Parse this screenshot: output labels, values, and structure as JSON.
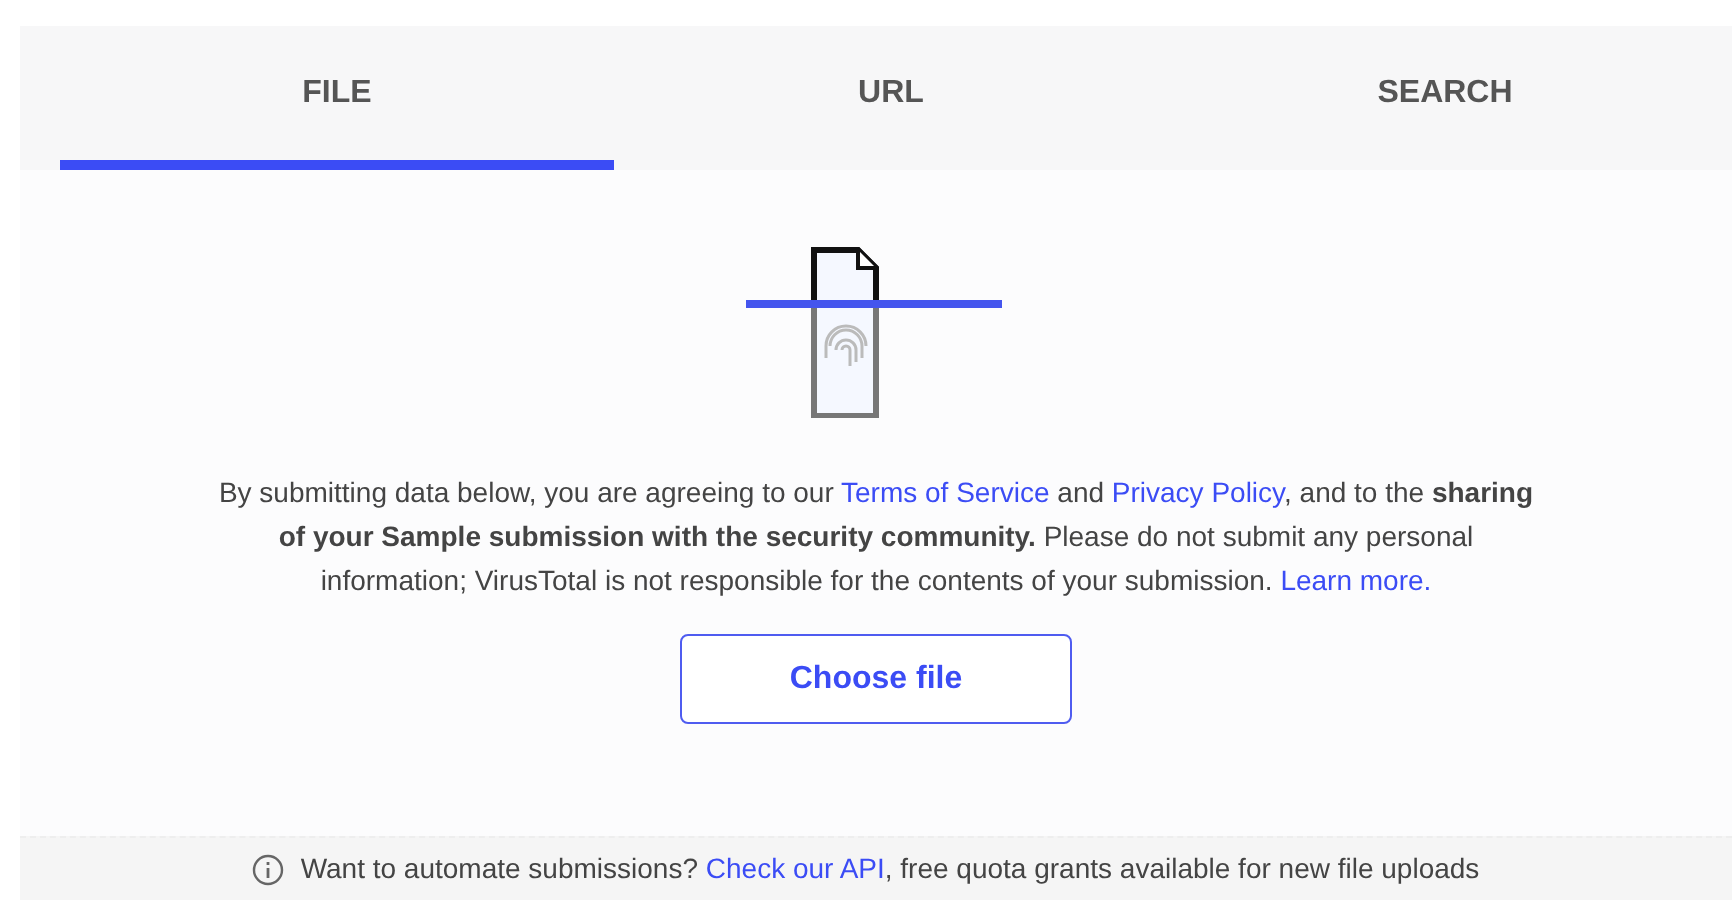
{
  "tabs": [
    {
      "label": "FILE",
      "selected": true
    },
    {
      "label": "URL",
      "selected": false
    },
    {
      "label": "SEARCH",
      "selected": false
    }
  ],
  "notice": [
    {
      "kind": "text",
      "text": "By submitting data below, you are agreeing to our "
    },
    {
      "kind": "link",
      "text": "Terms of Service"
    },
    {
      "kind": "text",
      "text": " and "
    },
    {
      "kind": "link",
      "text": "Privacy Policy"
    },
    {
      "kind": "text",
      "text": ", and to the "
    },
    {
      "kind": "bold",
      "text": "sharing of your Sample submission with the security community."
    },
    {
      "kind": "text",
      "text": " Please do not submit any personal information; VirusTotal is not responsible for the contents of your submission. "
    },
    {
      "kind": "link",
      "text": "Learn more."
    }
  ],
  "choose_button": "Choose file",
  "footer": [
    {
      "kind": "text",
      "text": "Want to automate submissions? "
    },
    {
      "kind": "link",
      "text": "Check our API"
    },
    {
      "kind": "text",
      "text": ", free quota grants available for new file uploads"
    }
  ]
}
